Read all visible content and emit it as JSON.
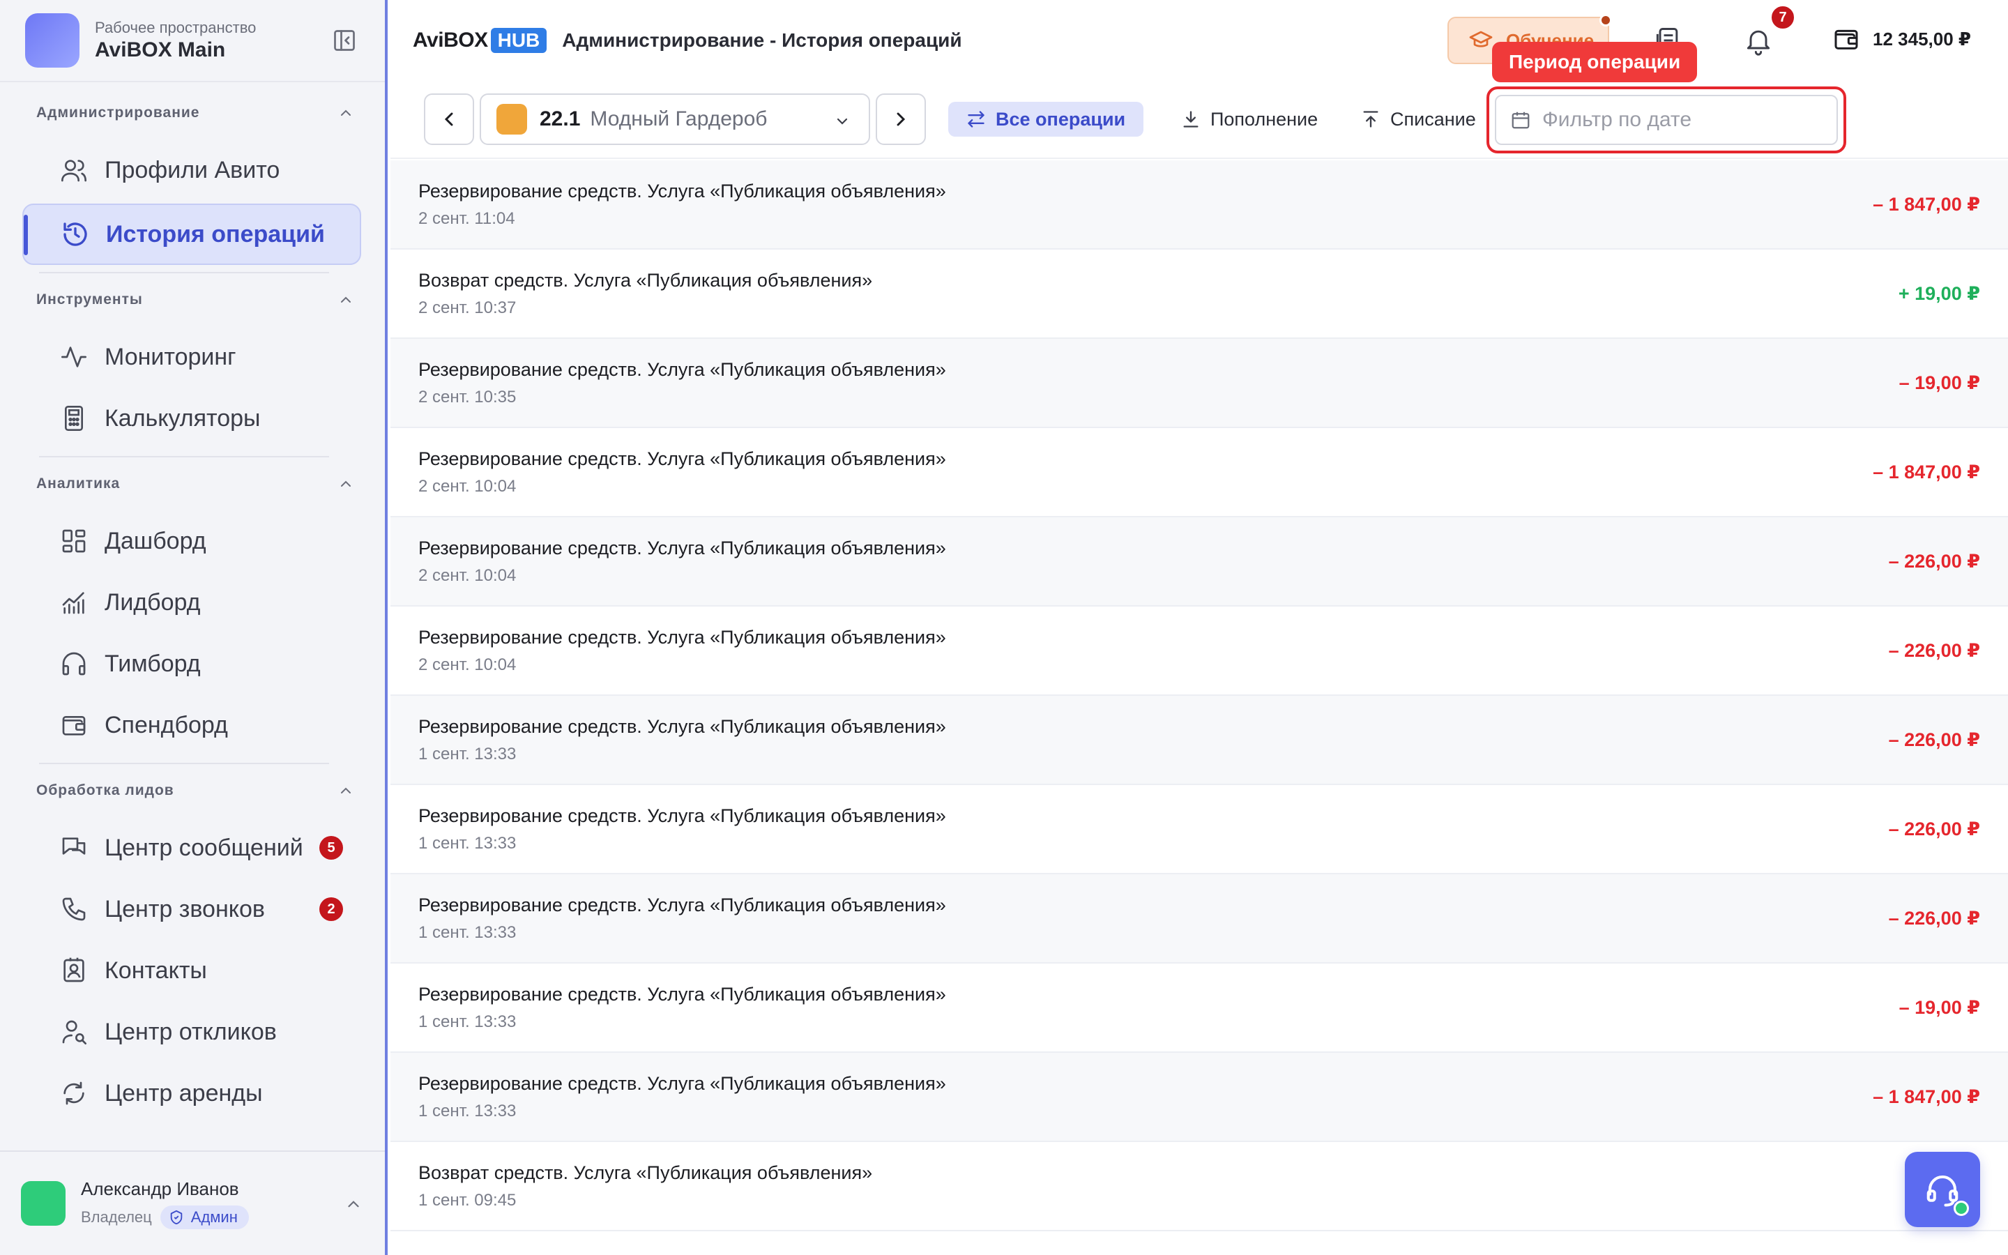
{
  "workspace": {
    "label": "Рабочее пространство",
    "name": "AviBOX Main"
  },
  "sidebar": {
    "sections": [
      {
        "title": "Администрирование",
        "items": [
          {
            "label": "Профили Авито",
            "icon": "users-icon"
          },
          {
            "label": "История операций",
            "icon": "history-icon",
            "active": true
          }
        ]
      },
      {
        "title": "Инструменты",
        "items": [
          {
            "label": "Мониторинг",
            "icon": "activity-icon"
          },
          {
            "label": "Калькуляторы",
            "icon": "calculator-icon"
          }
        ]
      },
      {
        "title": "Аналитика",
        "items": [
          {
            "label": "Дашборд",
            "icon": "dashboard-icon"
          },
          {
            "label": "Лидборд",
            "icon": "chart-icon"
          },
          {
            "label": "Тимборд",
            "icon": "headphones-icon"
          },
          {
            "label": "Спендборд",
            "icon": "wallet-icon"
          }
        ]
      },
      {
        "title": "Обработка лидов",
        "items": [
          {
            "label": "Центр сообщений",
            "icon": "messages-icon",
            "badge": "5"
          },
          {
            "label": "Центр звонков",
            "icon": "phone-icon",
            "badge": "2"
          },
          {
            "label": "Контакты",
            "icon": "contacts-icon"
          },
          {
            "label": "Центр откликов",
            "icon": "user-search-icon"
          },
          {
            "label": "Центр аренды",
            "icon": "refresh-icon"
          }
        ]
      }
    ]
  },
  "user": {
    "name": "Александр Иванов",
    "role": "Владелец",
    "badge": "Админ"
  },
  "header": {
    "logo_text": "AviBOX",
    "logo_badge": "HUB",
    "title": "Администрирование - История операций",
    "learn_label": "Обучение",
    "notifications_count": "7",
    "balance": "12 345,00 ₽"
  },
  "filters": {
    "account_number": "22.1",
    "account_name": "Модный Гардероб",
    "tabs": [
      {
        "label": "Все операции",
        "icon": "arrows-swap-icon",
        "active": true
      },
      {
        "label": "Пополнение",
        "icon": "download-icon"
      },
      {
        "label": "Списание",
        "icon": "upload-icon"
      }
    ],
    "date_placeholder": "Фильтр по дате",
    "tooltip": "Период операции"
  },
  "operations": [
    {
      "title": "Резервирование средств. Услуга «Публикация объявления»",
      "date": "2 сент. 11:04",
      "amount": "– 1 847,00 ₽",
      "sign": "neg"
    },
    {
      "title": "Возврат средств. Услуга «Публикация объявления»",
      "date": "2 сент. 10:37",
      "amount": "+ 19,00 ₽",
      "sign": "pos"
    },
    {
      "title": "Резервирование средств. Услуга «Публикация объявления»",
      "date": "2 сент. 10:35",
      "amount": "– 19,00 ₽",
      "sign": "neg"
    },
    {
      "title": "Резервирование средств. Услуга «Публикация объявления»",
      "date": "2 сент. 10:04",
      "amount": "– 1 847,00 ₽",
      "sign": "neg"
    },
    {
      "title": "Резервирование средств. Услуга «Публикация объявления»",
      "date": "2 сент. 10:04",
      "amount": "– 226,00 ₽",
      "sign": "neg"
    },
    {
      "title": "Резервирование средств. Услуга «Публикация объявления»",
      "date": "2 сент. 10:04",
      "amount": "– 226,00 ₽",
      "sign": "neg"
    },
    {
      "title": "Резервирование средств. Услуга «Публикация объявления»",
      "date": "1 сент. 13:33",
      "amount": "– 226,00 ₽",
      "sign": "neg"
    },
    {
      "title": "Резервирование средств. Услуга «Публикация объявления»",
      "date": "1 сент. 13:33",
      "amount": "– 226,00 ₽",
      "sign": "neg"
    },
    {
      "title": "Резервирование средств. Услуга «Публикация объявления»",
      "date": "1 сент. 13:33",
      "amount": "– 226,00 ₽",
      "sign": "neg"
    },
    {
      "title": "Резервирование средств. Услуга «Публикация объявления»",
      "date": "1 сент. 13:33",
      "amount": "– 19,00 ₽",
      "sign": "neg"
    },
    {
      "title": "Резервирование средств. Услуга «Публикация объявления»",
      "date": "1 сент. 13:33",
      "amount": "– 1 847,00 ₽",
      "sign": "neg"
    },
    {
      "title": "Возврат средств. Услуга «Публикация объявления»",
      "date": "1 сент. 09:45",
      "amount": "+",
      "sign": "pos"
    }
  ],
  "colors": {
    "accent": "#3b4bc9",
    "negative": "#e5262d",
    "positive": "#1eaf5a",
    "highlight": "#e5262d"
  }
}
